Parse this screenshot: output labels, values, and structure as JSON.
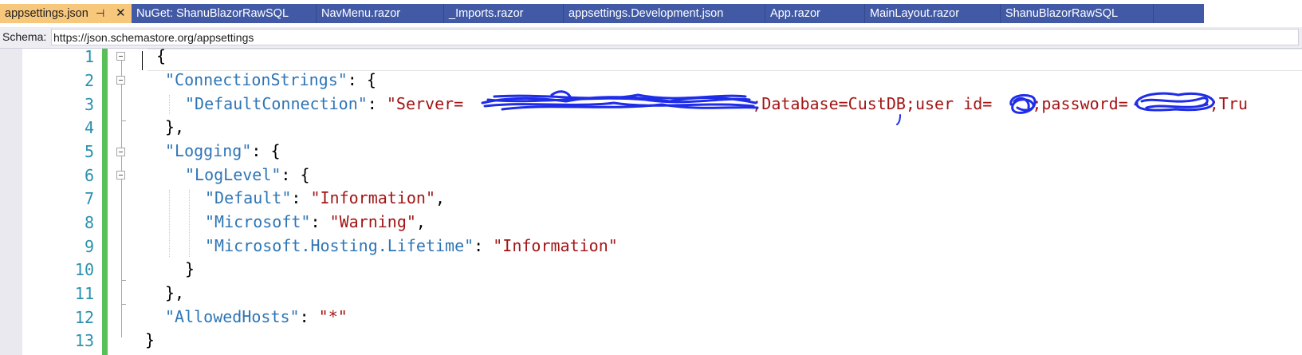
{
  "tabs": [
    {
      "label": "appsettings.json",
      "active": true
    },
    {
      "label": "NuGet: ShanuBlazorRawSQL"
    },
    {
      "label": "NavMenu.razor"
    },
    {
      "label": "_Imports.razor"
    },
    {
      "label": "appsettings.Development.json"
    },
    {
      "label": "App.razor"
    },
    {
      "label": "MainLayout.razor"
    },
    {
      "label": "ShanuBlazorRawSQL"
    }
  ],
  "tab_pin_icon": "pin-icon",
  "tab_close_icon": "close-icon",
  "schema": {
    "label": "Schema:",
    "value": "https://json.schemastore.org/appsettings"
  },
  "line_numbers": [
    "1",
    "2",
    "3",
    "4",
    "5",
    "6",
    "7",
    "8",
    "9",
    "10",
    "11",
    "12",
    "13"
  ],
  "code": {
    "l1": "{",
    "l2_key": "\"ConnectionStrings\"",
    "l2_rest": ": {",
    "l3_key": "\"DefaultConnection\"",
    "l3_colon": ": ",
    "l3_v1": "\"Server= ",
    "l3_v2": ";Database=CustDB;user id= ",
    "l3_v3": ";password=",
    "l3_v4": ";Tru",
    "l4": "},",
    "l5_key": "\"Logging\"",
    "l5_rest": ": {",
    "l6_key": "\"LogLevel\"",
    "l6_rest": ": {",
    "l7_key": "\"Default\"",
    "l7_colon": ": ",
    "l7_val": "\"Information\"",
    "l7_end": ",",
    "l8_key": "\"Microsoft\"",
    "l8_colon": ": ",
    "l8_val": "\"Warning\"",
    "l8_end": ",",
    "l9_key": "\"Microsoft.Hosting.Lifetime\"",
    "l9_colon": ": ",
    "l9_val": "\"Information\"",
    "l10": "}",
    "l11": "},",
    "l12_key": "\"AllowedHosts\"",
    "l12_colon": ": ",
    "l12_val": "\"*\"",
    "l13": "}"
  },
  "colors": {
    "tab_bg": "#425aa6",
    "tab_active_bg": "#f7c77c",
    "json_key": "#2e75b6",
    "json_string": "#a31515",
    "line_number": "#2b91af",
    "change_bar": "#57c157",
    "redaction_scribble": "#1f2de8"
  }
}
